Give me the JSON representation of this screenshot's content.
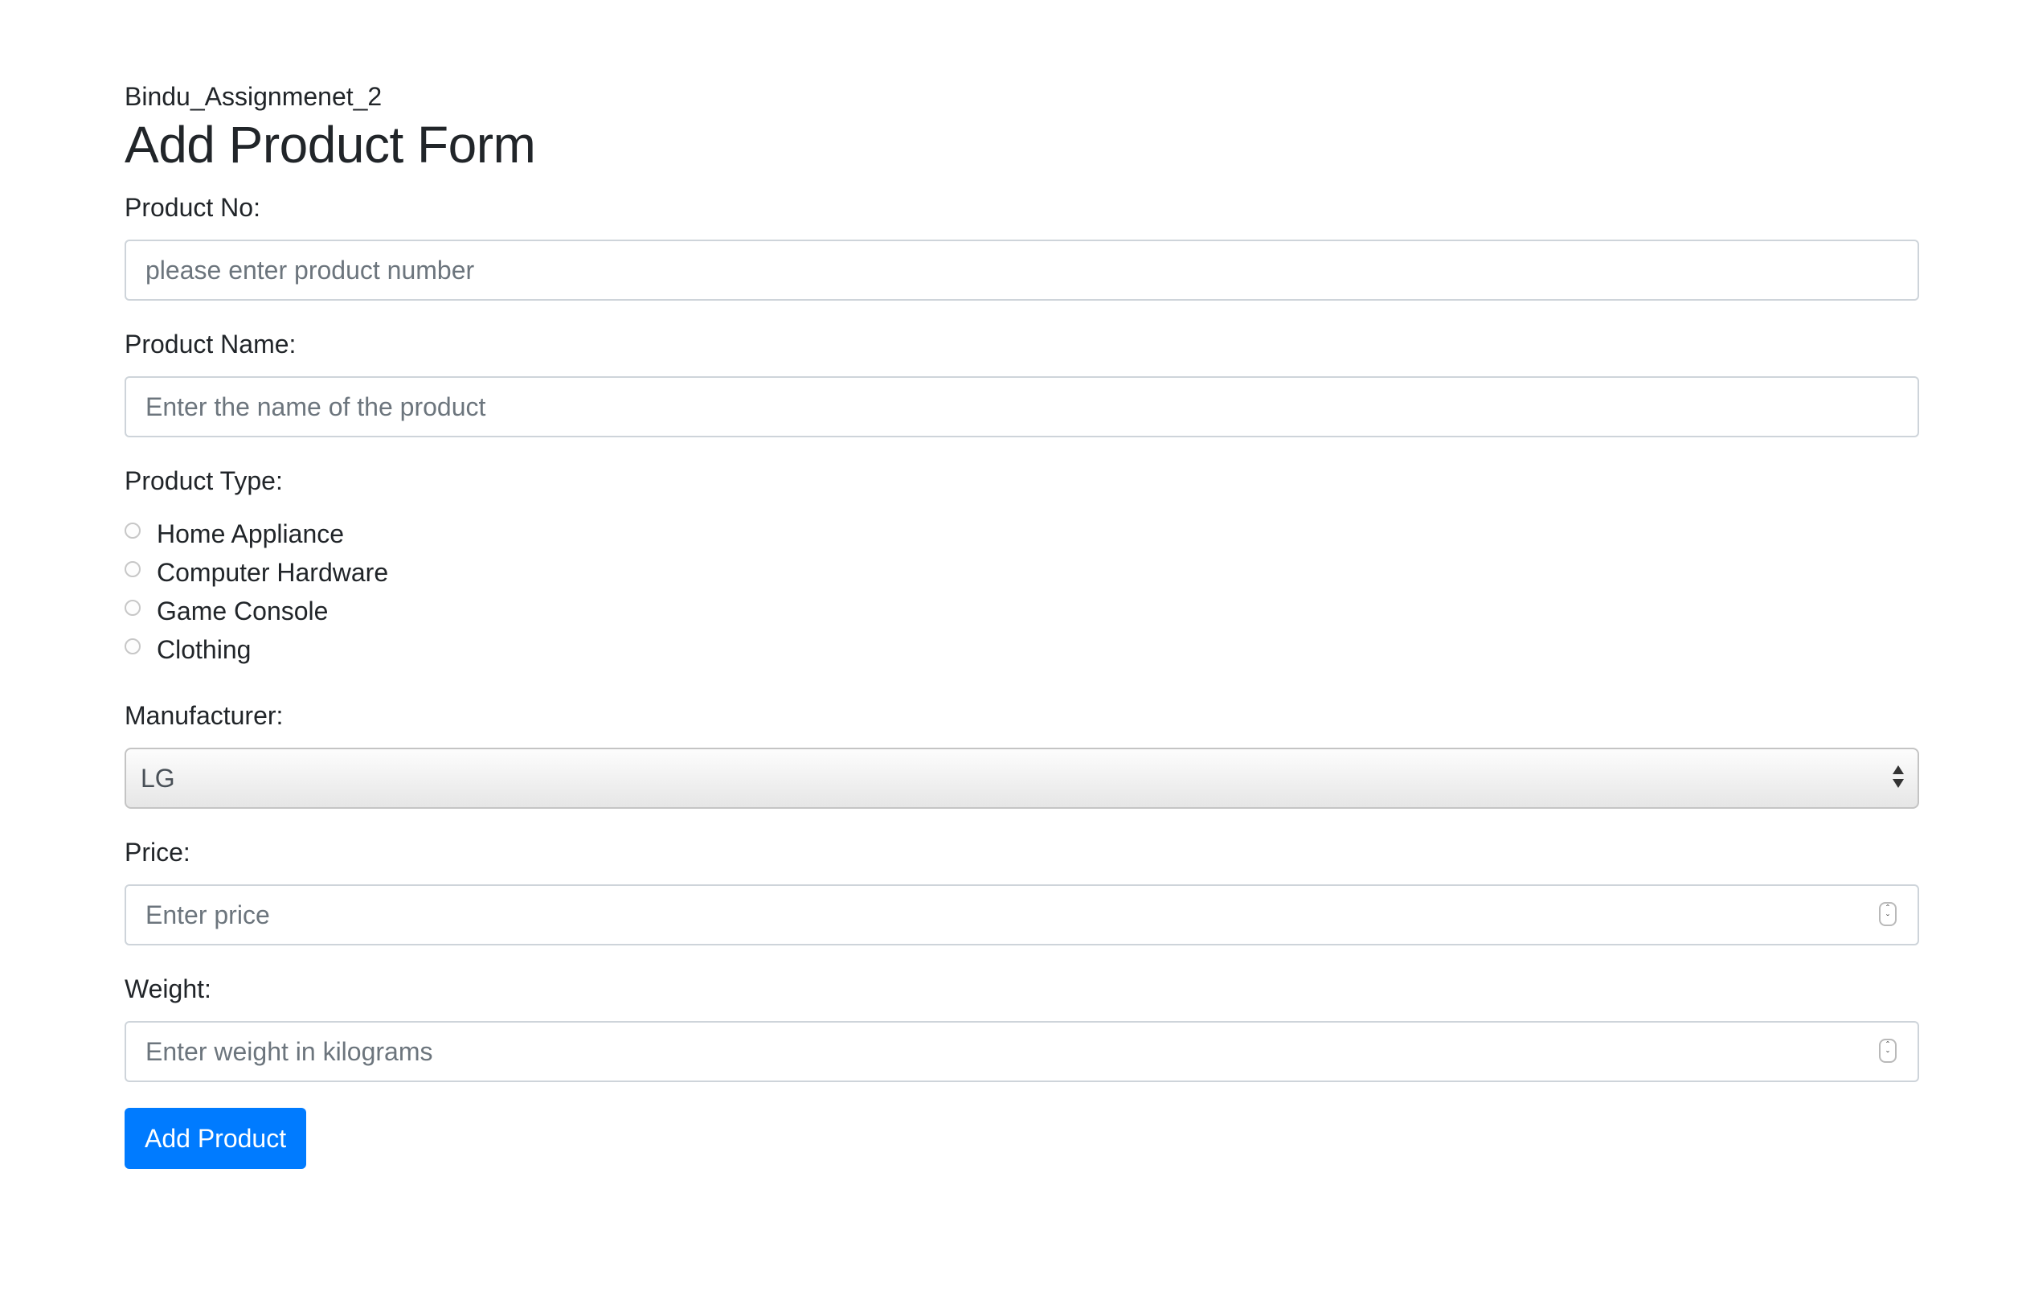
{
  "app": {
    "subtitle": "Bindu_Assignmenet_2",
    "title": "Add Product Form"
  },
  "form": {
    "product_no": {
      "label": "Product No:",
      "placeholder": "please enter product number",
      "value": ""
    },
    "product_name": {
      "label": "Product Name:",
      "placeholder": "Enter the name of the product",
      "value": ""
    },
    "product_type": {
      "label": "Product Type:",
      "options": [
        {
          "label": "Home Appliance",
          "checked": false
        },
        {
          "label": "Computer Hardware",
          "checked": false
        },
        {
          "label": "Game Console",
          "checked": false
        },
        {
          "label": "Clothing",
          "checked": false
        }
      ]
    },
    "manufacturer": {
      "label": "Manufacturer:",
      "selected": "LG"
    },
    "price": {
      "label": "Price:",
      "placeholder": "Enter price",
      "value": ""
    },
    "weight": {
      "label": "Weight:",
      "placeholder": "Enter weight in kilograms",
      "value": ""
    },
    "submit_label": "Add Product"
  },
  "colors": {
    "primary": "#007bff",
    "text": "#212529",
    "placeholder": "#6c757d",
    "border": "#ced4da"
  }
}
